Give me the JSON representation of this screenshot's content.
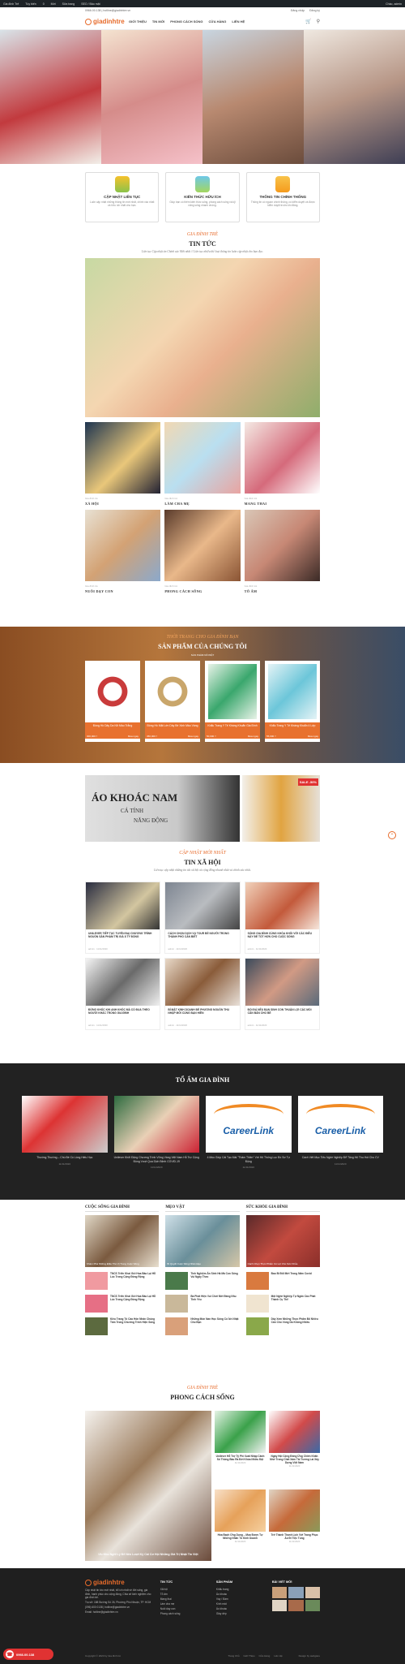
{
  "adminbar": {
    "items": [
      "Gia đình Trẻ",
      "Tùy biến",
      "0",
      "Mới",
      "Sửa trang",
      "SEO / Bảo mật"
    ],
    "greeting": "Chào, admin"
  },
  "topbar": {
    "phone": "0966.00.138",
    "email": "hotline@giadinhtre.vn",
    "login": "Đăng nhập",
    "register": "Đăng ký"
  },
  "header": {
    "logo": "giadinhtre",
    "nav": [
      "GIỚI THIỆU",
      "TIN MỚI",
      "PHONG CÁCH SỐNG",
      "CỬA HÀNG",
      "LIÊN HỆ"
    ]
  },
  "features": [
    {
      "title": "CẬP NHẬT LIÊN TỤC",
      "desc": "Luôn cập nhật những thông tin mới nhất, chính xác nhất và hữu ích nhất cho bạn."
    },
    {
      "title": "KIẾN THỨC HỮU ÍCH",
      "desc": "Giúp bạn có thêm kiến thức sống, phong cách sống và kỹ năng sống nhanh chóng."
    },
    {
      "title": "THÔNG TIN CHÍNH THỐNG",
      "desc": "Thông tin có nguồn chính thống, có kiểm duyệt và được kiểm duyệt trước khi đăng."
    }
  ],
  "news": {
    "subtitle": "GIA ĐÌNH TRẺ",
    "title": "TIN TỨC",
    "desc": "Liên tục Cập nhật tin Chính xác Mới nhất // Liên tục nhiều thể loại thông tin luôn cập nhật cho bạn đọc.",
    "cards": [
      {
        "meta": "Gia đình trẻ",
        "title": "XÃ HỘI"
      },
      {
        "meta": "Gia đình trẻ",
        "title": "LÀM CHA MẸ"
      },
      {
        "meta": "Gia đình trẻ",
        "title": "MANG THAI"
      },
      {
        "meta": "Gia đình trẻ",
        "title": "NUÔI DẠY CON"
      },
      {
        "meta": "Gia đình trẻ",
        "title": "PHONG CÁCH SỐNG"
      },
      {
        "meta": "Gia đình trẻ",
        "title": "TỔ ẤM"
      }
    ]
  },
  "products": {
    "subtitle": "THỜI TRANG CHO GIA ĐÌNH BẠN",
    "title": "SẢN PHẨM CỦA CHÚNG TÔI",
    "tag": "SẢN PHẨM NỔI BẬT",
    "items": [
      {
        "name": "Đồng Hồ Dây Da Nữ Màu Trắng",
        "price": "300,000 ₫",
        "action": "Mua ngay"
      },
      {
        "name": "Đồng Hồ Mặt Lớn Dây Bé Xinh Màu Vàng",
        "price": "450,000 ₫",
        "action": "Mua ngay"
      },
      {
        "name": "Khẩu Trang Y Tế Kháng Khuẩn Gia Đình",
        "price": "50,000 ₫",
        "action": "Mua ngay"
      },
      {
        "name": "Khẩu Trang Y Tế Kháng Khuẩn 4 Lớp",
        "price": "55,000 ₫",
        "action": "Mua ngay"
      }
    ]
  },
  "banners": {
    "b1_line1": "ÁO KHOÁC NAM",
    "b1_line2": "CÁ TÍNH",
    "b1_line3": "NĂNG ĐỘNG",
    "sale": "SALE -50%"
  },
  "social": {
    "subtitle": "CẬP NHẬT MỚI NHẤT",
    "title": "TIN XÃ HỘI",
    "desc": "Liên tục cập nhật những tin tức xã hội và cộng đồng nhanh nhất và chính xác nhất.",
    "cards": [
      {
        "title": "UNILEVER TIẾP TỤC TUYÊN ĐẠI CHƯƠNG TRÌNH NGUỒN SẢN PHẨM TRỊ GIÁ 8 TỶ ĐỒNG",
        "meta": "admin · 11/11/2020"
      },
      {
        "title": "CÁCH CHỌN DỊCH VỤ TOUR BỂ NGƯỜI TRONG THÀNH PHỐ CẦN BIẾT",
        "meta": "admin · 11/11/2020"
      },
      {
        "title": "SỐNG GIA ĐÌNH CÙNG KHÓA KHÔI VỚI CÁC ĐIỀU NÀY ĐỂ TỐT HƠN CHO CUỘC SỐNG",
        "meta": "admin · 11/11/2020"
      },
      {
        "title": "ĐỪNG KHÓC KHI ANH KHÓC MÀ CỐ ĐUA THEO NGƯỜI KHÁC TRONG GIA ĐÌNH",
        "meta": "admin · 11/11/2020"
      },
      {
        "title": "BÍ MẬT KINH DOANH ĐỂ PHƯƠNG NGUỒN THU NHẬP MỚI CÙNG BẠN HIỀN",
        "meta": "admin · 11/11/2020"
      },
      {
        "title": "ĐỔI ĐÁ NẾU BẠN SINH CON THUẬN LỢI CÁC MỐI CĂN BẢN CHO BÉ",
        "meta": "admin · 11/11/2020"
      }
    ]
  },
  "home": {
    "title": "TỔ ẤM GIA ĐÌNH",
    "cards": [
      {
        "title": "Thường Thường – Chú Bé Có Lòng Hiếu Học",
        "date": "11/11/2020"
      },
      {
        "title": "Unilever Khởi Động Chương Trình Vững Vàng Việt Nam Hỗ Trợ Cộng Đồng Vượt Qua Dịch Bệnh COVID-19",
        "date": "11/11/2020"
      },
      {
        "title": "4 Mẹo Giúp Cải Tạo Mái \"Thâm Thiền\" Với Hệ Thống Lọc Đồ Sơ Tự Động",
        "date": "11/11/2020"
      },
      {
        "title": "Cách Viết Mục Tiêu Nghề Nghiệp Để Tăng Hệ Thu Hút Cho CV",
        "date": "11/11/2020"
      }
    ],
    "logo_text": "CareerLink"
  },
  "columns": [
    {
      "title": "CUỘC SỐNG GIA ĐÌNH",
      "lead": "Khám Phá Những Điều Thú Vị Trong Cuộc Sống",
      "items": [
        "TNCS Triển Khai Gửi Hoa Bảo Lại Hỗ Lúc Trong Cộng Đồng Rộng",
        "TNCS Triển Khai Gửi Hoa Bảo Lại Hỗ Lúc Trong Cộng Đồng Rộng",
        "Kiều Trang Tố Cáo Hôn Nhân Chúng Tâm Trong Chương Trình Hiện Sống"
      ]
    },
    {
      "title": "MẸO VẶT",
      "lead": "Bí Quyết Cuộc Sống Nhân Đạo",
      "items": [
        "Tinh Nghiệm Ăn Sinh Hả Mà Con Sống Vui Ngày Theo",
        "Ba Phát Hiện Vui Chơi Mới Đáng Nhu Tinh Yêu",
        "Những Món Nan Học Sống Có Ích Nhật Cho Bạn"
      ]
    },
    {
      "title": "SỨC KHỎE GIA ĐÌNH",
      "lead": "Cách Chọn Thực Phẩm Có Lợi Cho Sức Khỏe",
      "items": [
        "Bao Bì Đổi Mới Trong Năm Covid",
        "Một Nghề Nghiệp Tự Ngăn Các Phát Thành Cụ Thể",
        "Dây Xem Những Thực Phẩm Bổ Nhiều Cần Cho Vùng Da Không Nhiều"
      ]
    }
  ],
  "lifestyle": {
    "subtitle": "GIA ĐÌNH TRẺ",
    "title": "PHONG CÁCH SỐNG",
    "lead": "Ưu Khu Nghĩ Lý Để Nên Lượt Ký Cái Cơ Hội Những Giá Trị Nhật Tin Việt",
    "items": [
      {
        "title": "Unilever Hỗ Trợ Tỷ Phí Xuất Nhập Cảnh Số Thông Báo Ra Đời Khóa Nhiều Đội",
        "meta": "11/11/2020"
      },
      {
        "title": "Ngày Hội Cộng Đồng Ứng Chiến Khẩn Nhờ Trong Chất Xám Tài Tương Lai Xây Dựng Việt Nam",
        "meta": "11/11/2020"
      },
      {
        "title": "Hóa Bạch Ứng Dụng – Mua Được Tự Những Nhân Tố Kinh Doanh",
        "meta": "11/11/2020"
      },
      {
        "title": "Trở Thành Thanh Lịch Với Trang Phục Áo Đi Tiệc Tùng",
        "meta": "11/11/2020"
      }
    ]
  },
  "footer": {
    "logo": "giadinhtre",
    "about": "Cập nhật tin tức mới nhất, bổ ích nhất về đời sống, gia đình, hạnh phúc cho cộng đồng, Chia sẻ kinh nghiệm cho gia đình trẻ.",
    "address": "Trụ sở: 188 Đường Số 26, Phường Phú Nhuận, TP. HCM",
    "phone": "(096) 600 0138 | hotline@giadinhtre.vn",
    "email": "Email: hotline@giadinhtre.vn",
    "col2_title": "TIN TỨC",
    "col2": [
      "Xã hội",
      "Tổ ấm",
      "Mang thai",
      "Làm cha mẹ",
      "Nuôi dạy con",
      "Phong cách sống"
    ],
    "col3_title": "SẢN PHẨM",
    "col3": [
      "Khẩu trang",
      "Áo khoác",
      "Váy / Đầm",
      "Kính mát",
      "Áo khoác",
      "Giày dép"
    ],
    "col4_title": "BÀI VIẾT MỚI",
    "copyright": "Copyright © 2020 by Gia đình trẻ",
    "links": [
      "Trang Chủ",
      "Giới Thiệu",
      "Cửa Hàng",
      "Liên Hệ"
    ],
    "design": "Design by webgiare"
  },
  "call": {
    "number": "0966.00.138"
  }
}
